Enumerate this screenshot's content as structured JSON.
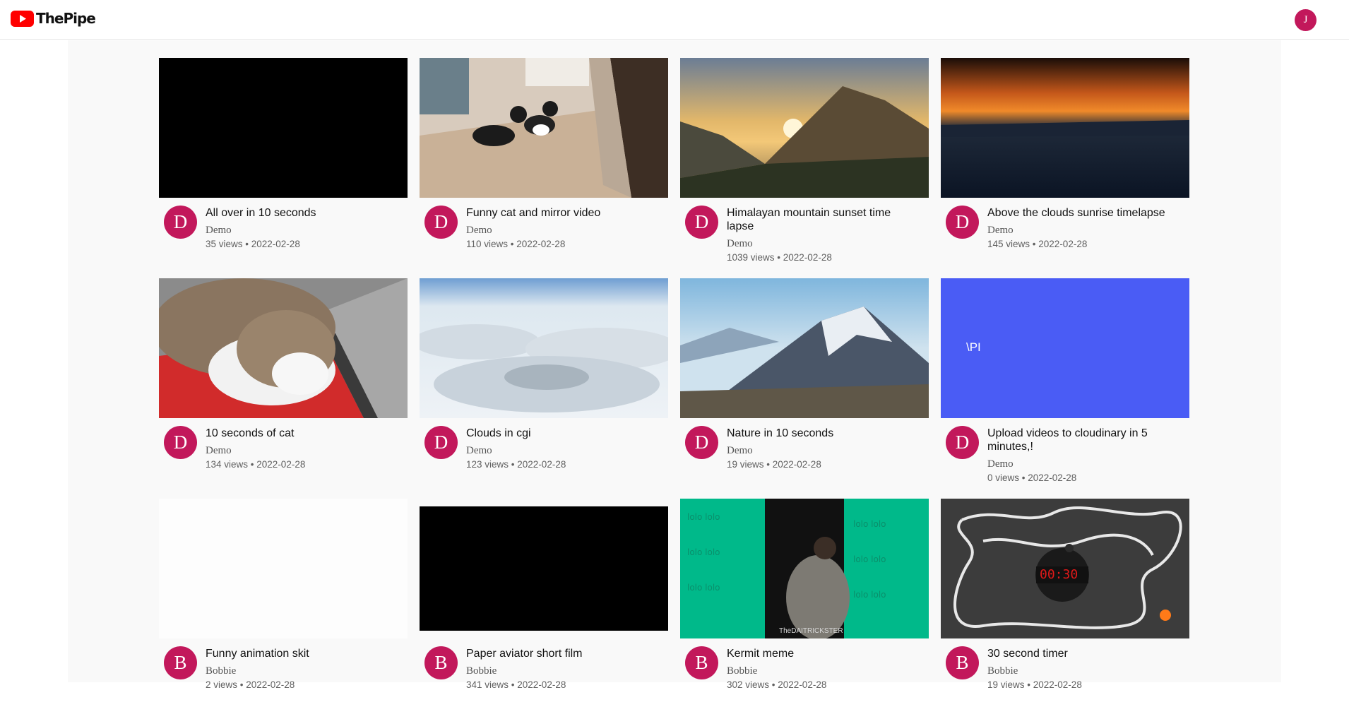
{
  "header": {
    "app_name": "ThePipe",
    "logo_icon": "youtube-play-icon",
    "user_initial": "J",
    "colors": {
      "logo_red": "#ff0000",
      "avatar": "#c2185b"
    }
  },
  "videos": [
    {
      "title": "All over in 10 seconds",
      "channel": "Demo",
      "avatar_initial": "D",
      "views": "35 views",
      "date": "2022-02-28"
    },
    {
      "title": "Funny cat and mirror video",
      "channel": "Demo",
      "avatar_initial": "D",
      "views": "110 views",
      "date": "2022-02-28"
    },
    {
      "title": "Himalayan mountain sunset time lapse",
      "channel": "Demo",
      "avatar_initial": "D",
      "views": "1039 views",
      "date": "2022-02-28"
    },
    {
      "title": "Above the clouds sunrise timelapse",
      "channel": "Demo",
      "avatar_initial": "D",
      "views": "145 views",
      "date": "2022-02-28"
    },
    {
      "title": "10 seconds of cat",
      "channel": "Demo",
      "avatar_initial": "D",
      "views": "134 views",
      "date": "2022-02-28"
    },
    {
      "title": "Clouds in cgi",
      "channel": "Demo",
      "avatar_initial": "D",
      "views": "123 views",
      "date": "2022-02-28"
    },
    {
      "title": "Nature in 10 seconds",
      "channel": "Demo",
      "avatar_initial": "D",
      "views": "19 views",
      "date": "2022-02-28"
    },
    {
      "title": "Upload videos to cloudinary in 5 minutes,!",
      "channel": "Demo",
      "avatar_initial": "D",
      "views": "0 views",
      "date": "2022-02-28",
      "thumb_text": "\\PI"
    },
    {
      "title": "Funny animation skit",
      "channel": "Bobbie",
      "avatar_initial": "B",
      "views": "2 views",
      "date": "2022-02-28"
    },
    {
      "title": "Paper aviator short film",
      "channel": "Bobbie",
      "avatar_initial": "B",
      "views": "341 views",
      "date": "2022-02-28"
    },
    {
      "title": "Kermit meme",
      "channel": "Bobbie",
      "avatar_initial": "B",
      "views": "302 views",
      "date": "2022-02-28",
      "thumb_text": "TheDAITRICKSTER"
    },
    {
      "title": "30 second timer",
      "channel": "Bobbie",
      "avatar_initial": "B",
      "views": "19 views",
      "date": "2022-02-28",
      "thumb_text": "00:30"
    }
  ]
}
